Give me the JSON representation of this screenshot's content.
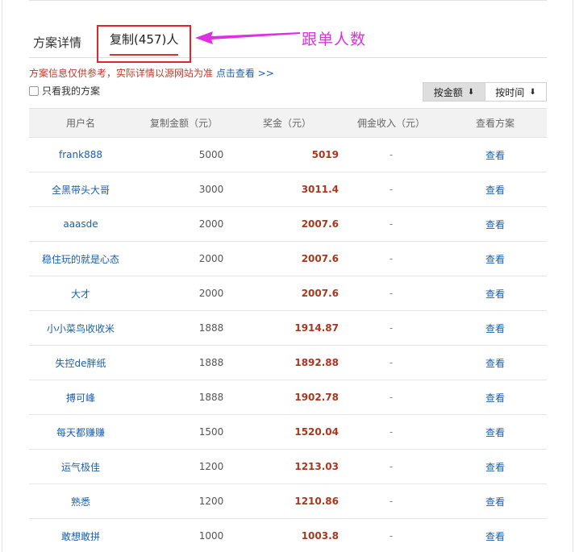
{
  "tabs": {
    "detail": "方案详情",
    "copy": "复制(457)人"
  },
  "annotation": "跟单人数",
  "notice": {
    "text": "方案信息仅供参考，实际详情以源网站为准",
    "link": "点击查看 >>"
  },
  "filter": {
    "label": "只看我的方案"
  },
  "sort": {
    "amount": "按金额",
    "time": "按时间"
  },
  "table": {
    "headers": [
      "用户名",
      "复制金额（元）",
      "奖金（元）",
      "佣金收入（元）",
      "查看方案"
    ],
    "rows": [
      {
        "user": "frank888",
        "amount": "5000",
        "prize": "5019",
        "commission": "-",
        "view": "查看"
      },
      {
        "user": "全黑带头大哥",
        "amount": "3000",
        "prize": "3011.4",
        "commission": "-",
        "view": "查看"
      },
      {
        "user": "aaasde",
        "amount": "2000",
        "prize": "2007.6",
        "commission": "-",
        "view": "查看"
      },
      {
        "user": "稳住玩的就是心态",
        "amount": "2000",
        "prize": "2007.6",
        "commission": "-",
        "view": "查看"
      },
      {
        "user": "大才",
        "amount": "2000",
        "prize": "2007.6",
        "commission": "-",
        "view": "查看"
      },
      {
        "user": "小小菜鸟收收米",
        "amount": "1888",
        "prize": "1914.87",
        "commission": "-",
        "view": "查看"
      },
      {
        "user": "失控de胖纸",
        "amount": "1888",
        "prize": "1892.88",
        "commission": "-",
        "view": "查看"
      },
      {
        "user": "搏可峰",
        "amount": "1888",
        "prize": "1902.78",
        "commission": "-",
        "view": "查看"
      },
      {
        "user": "每天都赚赚",
        "amount": "1500",
        "prize": "1520.04",
        "commission": "-",
        "view": "查看"
      },
      {
        "user": "运气极佳",
        "amount": "1200",
        "prize": "1213.03",
        "commission": "-",
        "view": "查看"
      },
      {
        "user": "熟悉",
        "amount": "1200",
        "prize": "1210.86",
        "commission": "-",
        "view": "查看"
      },
      {
        "user": "敢想敢拼",
        "amount": "1000",
        "prize": "1003.8",
        "commission": "-",
        "view": "查看"
      }
    ]
  },
  "colors": {
    "accent_red": "#d9322a",
    "annotation_magenta": "#e02fe0",
    "link_blue": "#1a5fa8",
    "prize_red": "#a8371e"
  }
}
